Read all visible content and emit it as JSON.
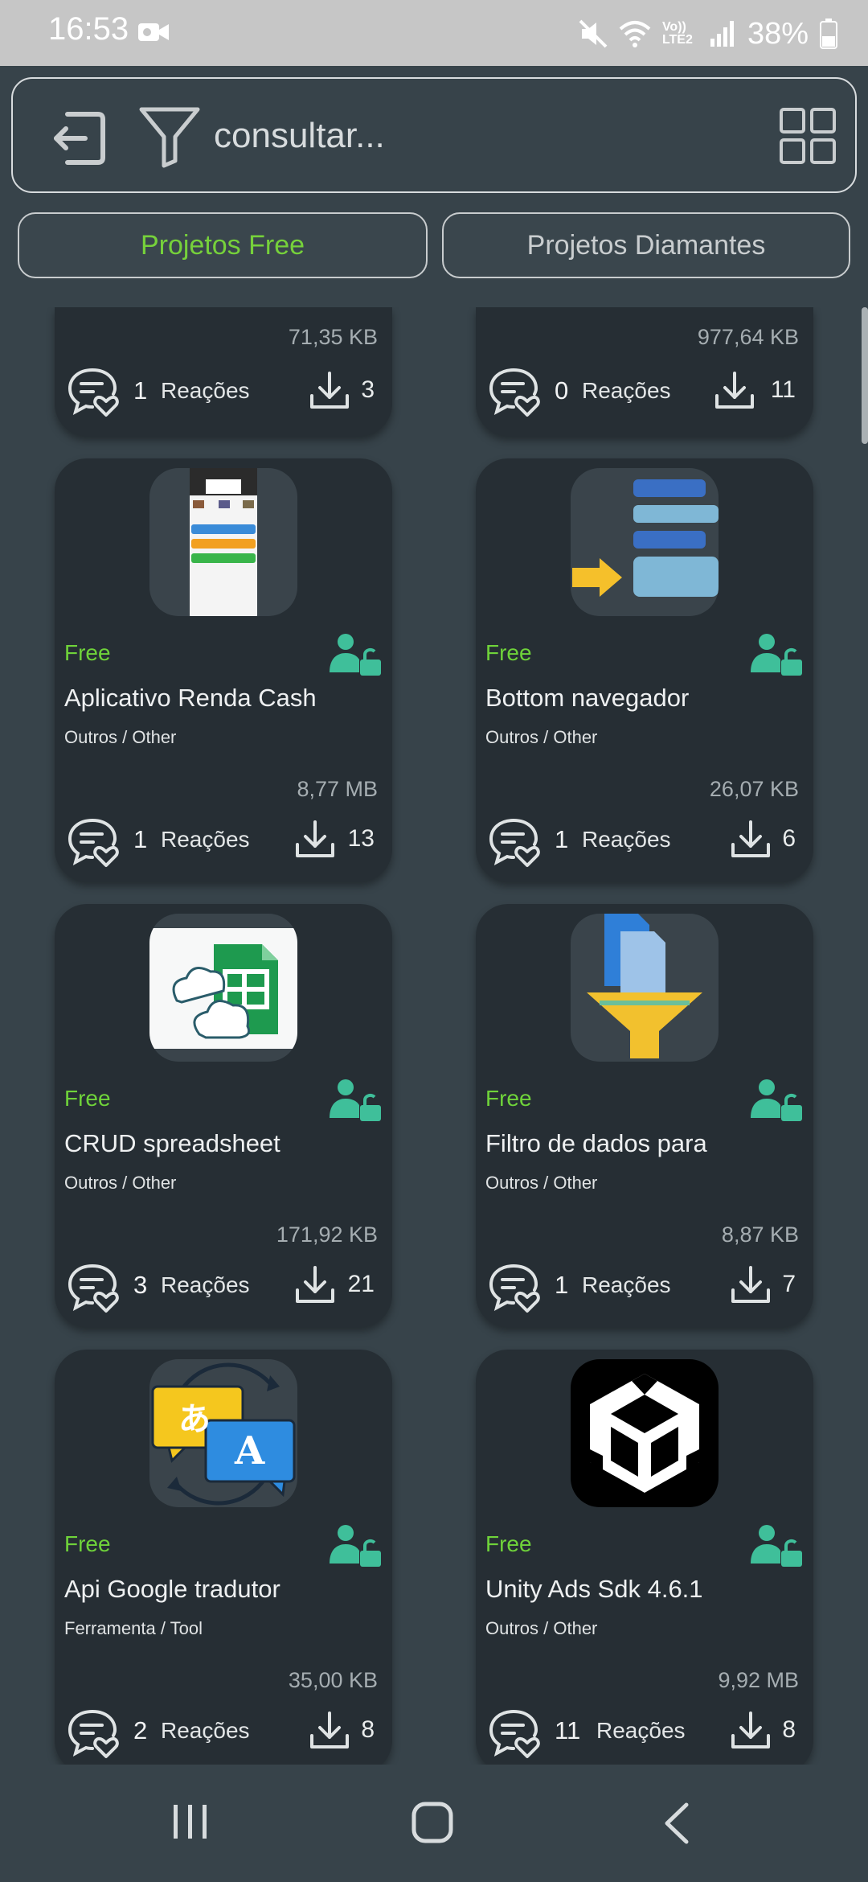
{
  "status_bar": {
    "time": "16:53",
    "network": "Vo)) LTE2",
    "battery": "38%"
  },
  "search": {
    "placeholder": "consultar..."
  },
  "tabs": [
    {
      "label": "Projetos Free",
      "active": true
    },
    {
      "label": "Projetos Diamantes",
      "active": false
    }
  ],
  "colors": {
    "background": "#37434a",
    "card": "#262e34",
    "accent_green": "#6fd33a",
    "lock_icon": "#3fbf9a"
  },
  "partial_cards": [
    {
      "size": "71,35 KB",
      "reactions": "1",
      "reactions_label": "Reações",
      "downloads": "3"
    },
    {
      "size": "977,64 KB",
      "reactions": "0",
      "reactions_label": "Reações",
      "downloads": "11"
    }
  ],
  "projects": [
    {
      "badge": "Free",
      "title": "Aplicativo Renda Cash",
      "category": "Outros / Other",
      "size": "8,77 MB",
      "reactions": "1",
      "reactions_label": "Reações",
      "downloads": "13",
      "icon": "app-screenshot-icon"
    },
    {
      "badge": "Free",
      "title": "Bottom navegador",
      "category": "Outros / Other",
      "size": "26,07 KB",
      "reactions": "1",
      "reactions_label": "Reações",
      "downloads": "6",
      "icon": "bottom-navigation-icon"
    },
    {
      "badge": "Free",
      "title": "CRUD spreadsheet",
      "category": "Outros / Other",
      "size": "171,92 KB",
      "reactions": "3",
      "reactions_label": "Reações",
      "downloads": "21",
      "icon": "sheets-cloud-icon"
    },
    {
      "badge": "Free",
      "title": "Filtro de dados para",
      "category": "Outros / Other",
      "size": "8,87 KB",
      "reactions": "1",
      "reactions_label": "Reações",
      "downloads": "7",
      "icon": "data-filter-icon"
    },
    {
      "badge": "Free",
      "title": "Api Google tradutor",
      "category": "Ferramenta / Tool",
      "size": "35,00 KB",
      "reactions": "2",
      "reactions_label": "Reações",
      "downloads": "8",
      "icon": "translate-icon",
      "glyph_a": "あ",
      "glyph_b": "A"
    },
    {
      "badge": "Free",
      "title": "Unity Ads Sdk 4.6.1",
      "category": "Outros / Other",
      "size": "9,92 MB",
      "reactions": "11",
      "reactions_label": "Reações",
      "downloads": "8",
      "icon": "unity-logo-icon"
    }
  ]
}
